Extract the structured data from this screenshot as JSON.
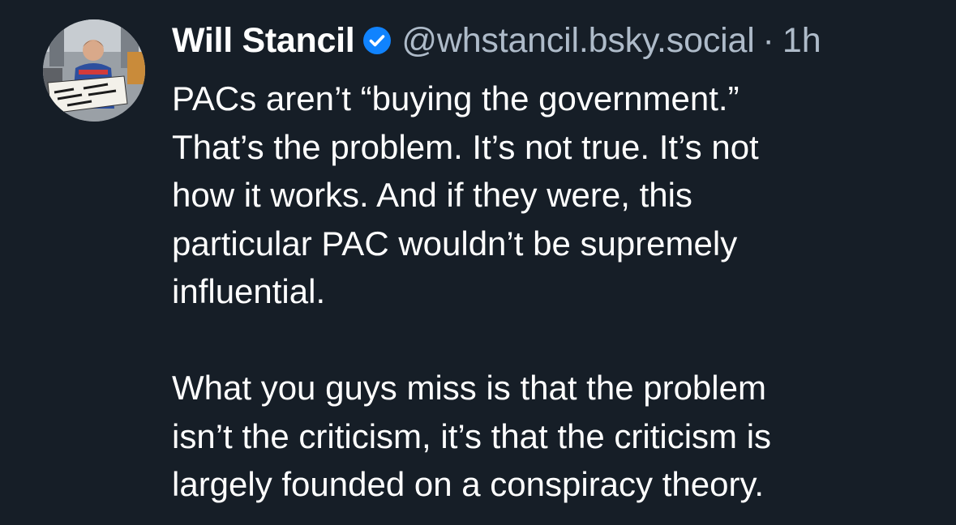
{
  "post": {
    "author": {
      "display_name": "Will Stancil",
      "handle": "@whstancil.bsky.social",
      "verified": true,
      "avatar_sign_text": "There are more of us than them"
    },
    "separator": "·",
    "timestamp": "1h",
    "paragraphs": [
      {
        "lines": [
          "PACs aren’t “buying the government.”",
          "That’s the problem. It’s not true. It’s not",
          "how it works. And if they were, this",
          "particular PAC wouldn’t be supremely",
          "influential."
        ]
      },
      {
        "lines": [
          "What you guys miss is that the problem",
          "isn’t the criticism, it’s that the criticism is",
          "largely founded on a conspiracy theory."
        ]
      }
    ]
  },
  "colors": {
    "background": "#161e27",
    "text": "#ffffff",
    "muted": "#aebbc9",
    "verified_badge": "#1083fe"
  }
}
